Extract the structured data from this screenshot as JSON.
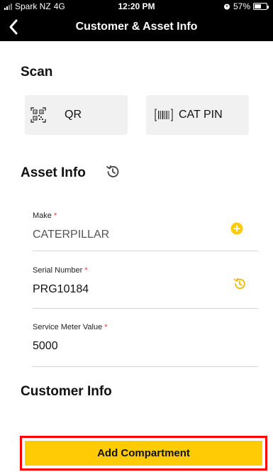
{
  "status_bar": {
    "carrier": "Spark NZ",
    "network": "4G",
    "time": "12:20 PM",
    "battery": "57%",
    "battery_level": 0.57
  },
  "nav": {
    "title": "Customer & Asset Info",
    "back_icon": "chevron-left-icon"
  },
  "scan": {
    "title": "Scan",
    "qr_label": "QR",
    "qr_icon": "qr-code-icon",
    "catpin_label": "CAT PIN",
    "catpin_icon": "barcode-icon"
  },
  "asset_info": {
    "title": "Asset Info",
    "history_icon": "history-icon",
    "fields": [
      {
        "label": "Make",
        "required_marker": "*",
        "value": "CATERPILLAR",
        "action_icon": "add-circle-icon"
      },
      {
        "label": "Serial Number",
        "required_marker": "*",
        "value": "PRG10184",
        "action_icon": "history-icon"
      },
      {
        "label": "Service Meter Value",
        "required_marker": "*",
        "value": "5000"
      }
    ]
  },
  "customer_info": {
    "title": "Customer Info"
  },
  "footer": {
    "add_compartment_label": "Add Compartment"
  },
  "colors": {
    "accent": "#fecb05",
    "required": "#e53935",
    "highlight_border": "#ff0000",
    "header_bg": "#000000"
  }
}
